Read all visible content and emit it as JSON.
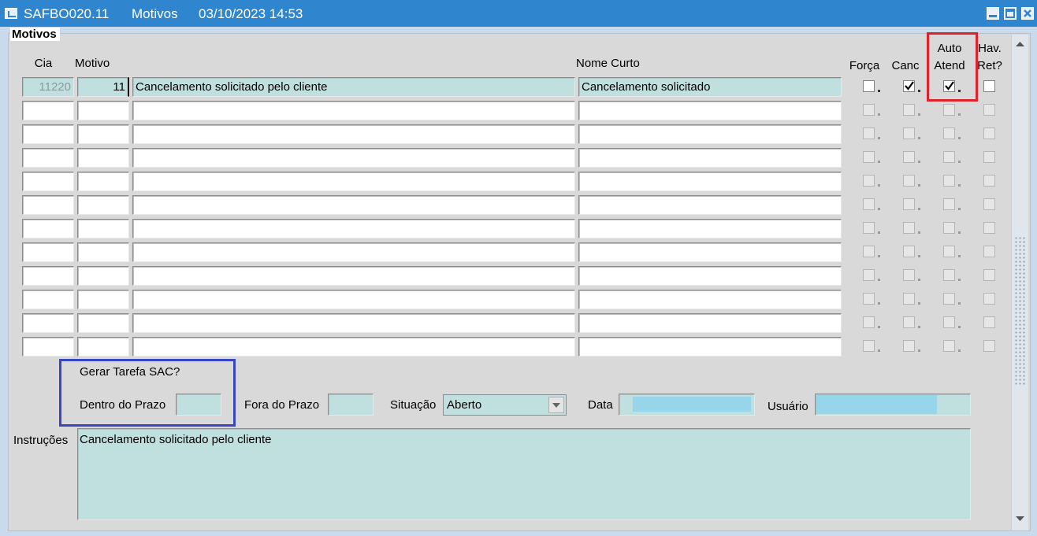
{
  "window": {
    "form_code": "SAFBO020.11",
    "form_name": "Motivos",
    "datetime": "03/10/2023 14:53"
  },
  "section": {
    "title": "Motivos"
  },
  "headers": {
    "cia": "Cia",
    "motivo": "Motivo",
    "nome_curto": "Nome Curto",
    "forca": "Força",
    "canc": "Canc",
    "auto_atend_1": "Auto",
    "auto_atend_2": "Atend",
    "hav_ret_1": "Hav.",
    "hav_ret_2": "Ret?"
  },
  "rows": [
    {
      "cia": "11220",
      "motivo": "11",
      "descricao": "Cancelamento solicitado pelo cliente",
      "nome_curto": "Cancelamento solicitado",
      "forca": false,
      "canc": true,
      "auto_atend": true,
      "hav_ret": false
    }
  ],
  "empty_row_count": 11,
  "gerar_tarefa": {
    "title": "Gerar Tarefa SAC?",
    "dentro_label": "Dentro do Prazo",
    "dentro_value": "",
    "fora_label": "Fora do Prazo",
    "fora_value": ""
  },
  "situacao": {
    "label": "Situação",
    "value": "Aberto"
  },
  "data_field": {
    "label": "Data",
    "value": ""
  },
  "usuario": {
    "label": "Usuário",
    "value": ""
  },
  "instrucoes": {
    "label": "Instruções",
    "value": "Cancelamento solicitado pelo cliente"
  },
  "colors": {
    "titlebar": "#2f86cf",
    "field_filled": "#c0e0df",
    "highlight_red": "#e0202a",
    "highlight_blue": "#3a45c2"
  }
}
